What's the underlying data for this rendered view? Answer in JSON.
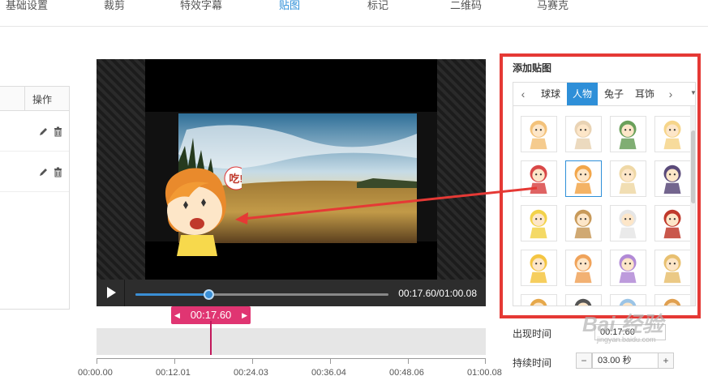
{
  "tabs": [
    "基础设置",
    "裁剪",
    "特效字幕",
    "贴图",
    "标记",
    "二维码",
    "马赛克"
  ],
  "active_tab": "贴图",
  "list_panel": {
    "header_action": "操作"
  },
  "player": {
    "time": "00:17.60/01:00.08",
    "progress": 0.29
  },
  "speech_bubble": "吃!",
  "timeline": {
    "marker": "00:17.60",
    "ticks": [
      "00:00.00",
      "00:12.01",
      "00:24.03",
      "00:36.04",
      "00:48.06",
      "01:00.08"
    ]
  },
  "sticker_panel": {
    "title": "添加贴图",
    "categories": [
      "球球",
      "人物",
      "兔子",
      "耳饰"
    ],
    "active_category": "人物",
    "selected_index": 5
  },
  "appear_time": {
    "label": "出现时间",
    "value": "00:17.60"
  },
  "duration": {
    "label": "持续时间",
    "value": "03.00 秒",
    "minus": "−",
    "plus": "+"
  },
  "watermark": {
    "text": "Bai 经验",
    "url": "jingyan.baidu.com"
  },
  "colors": {
    "accent": "#2e8fd8",
    "marker": "#e03572",
    "highlight": "#e53935"
  }
}
